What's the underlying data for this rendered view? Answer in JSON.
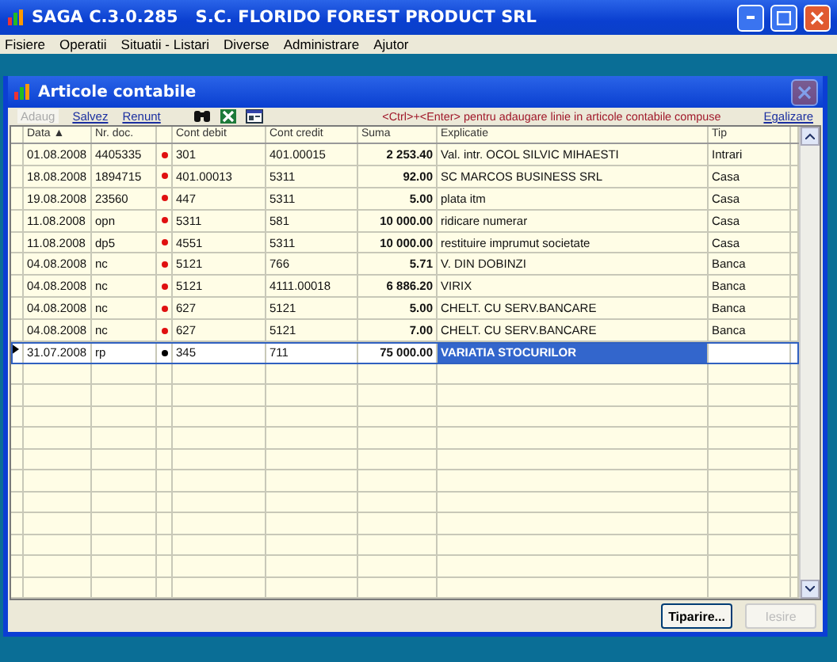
{
  "window": {
    "title": "SAGA C.3.0.285   S.C. FLORIDO FOREST PRODUCT SRL"
  },
  "menu": [
    "Fisiere",
    "Operatii",
    "Situatii - Listari",
    "Diverse",
    "Administrare",
    "Ajutor"
  ],
  "dialog": {
    "title": "Articole contabile",
    "toolbar": [
      {
        "label": "Adaug",
        "disabled": true
      },
      {
        "label": "Salvez",
        "disabled": false
      },
      {
        "label": "Renunt",
        "disabled": false
      }
    ],
    "hint": "<Ctrl>+<Enter> pentru adaugare linie in articole contabile compuse",
    "equalize": "Egalizare",
    "table": {
      "columns": [
        "Data",
        "Nr. doc.",
        "Cont debit",
        "Cont credit",
        "Suma",
        "Explicatie",
        "Tip"
      ],
      "sort_indicator": "▲",
      "rows": [
        {
          "data": "01.08.2008",
          "nr": "4405335",
          "color": "#e01010",
          "debit": "301",
          "credit": "401.00015",
          "suma": "2 253.40",
          "explicatie": "Val. intr. OCOL SILVIC MIHAESTI",
          "tip": "Intrari",
          "selected": false
        },
        {
          "data": "18.08.2008",
          "nr": "1894715",
          "color": "#e01010",
          "debit": "401.00013",
          "credit": "5311",
          "suma": "92.00",
          "explicatie": "SC MARCOS BUSINESS SRL",
          "tip": "Casa",
          "selected": false
        },
        {
          "data": "19.08.2008",
          "nr": "23560",
          "color": "#e01010",
          "debit": "447",
          "credit": "5311",
          "suma": "5.00",
          "explicatie": "plata itm",
          "tip": "Casa",
          "selected": false
        },
        {
          "data": "11.08.2008",
          "nr": "opn",
          "color": "#e01010",
          "debit": "5311",
          "credit": "581",
          "suma": "10 000.00",
          "explicatie": "ridicare numerar",
          "tip": "Casa",
          "selected": false
        },
        {
          "data": "11.08.2008",
          "nr": "dp5",
          "color": "#e01010",
          "debit": "4551",
          "credit": "5311",
          "suma": "10 000.00",
          "explicatie": "restituire imprumut societate",
          "tip": "Casa",
          "selected": false
        },
        {
          "data": "04.08.2008",
          "nr": "nc",
          "color": "#e01010",
          "debit": "5121",
          "credit": "766",
          "suma": "5.71",
          "explicatie": "V. DIN DOBINZI",
          "tip": "Banca",
          "selected": false
        },
        {
          "data": "04.08.2008",
          "nr": "nc",
          "color": "#e01010",
          "debit": "5121",
          "credit": "4111.00018",
          "suma": "6 886.20",
          "explicatie": "VIRIX",
          "tip": "Banca",
          "selected": false
        },
        {
          "data": "04.08.2008",
          "nr": "nc",
          "color": "#e01010",
          "debit": "627",
          "credit": "5121",
          "suma": "5.00",
          "explicatie": "CHELT. CU SERV.BANCARE",
          "tip": "Banca",
          "selected": false
        },
        {
          "data": "04.08.2008",
          "nr": "nc",
          "color": "#e01010",
          "debit": "627",
          "credit": "5121",
          "suma": "7.00",
          "explicatie": "CHELT. CU SERV.BANCARE",
          "tip": "Banca",
          "selected": false
        },
        {
          "data": "31.07.2008",
          "nr": "rp",
          "color": "#000000",
          "debit": "345",
          "credit": "711",
          "suma": "75 000.00",
          "explicatie": "VARIATIA STOCURILOR",
          "tip": "",
          "selected": true
        }
      ]
    },
    "buttons": [
      {
        "label": "Tiparire...",
        "disabled": false
      },
      {
        "label": "Iesire",
        "disabled": true
      }
    ]
  }
}
